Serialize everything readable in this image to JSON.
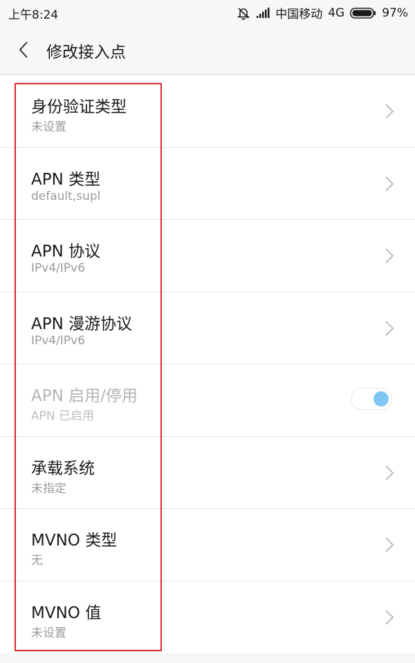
{
  "status_bar": {
    "time": "上午8:24",
    "carrier": "中国移动",
    "network": "4G",
    "battery": "97%",
    "icons": [
      "bell-off-icon",
      "signal-icon",
      "battery-icon"
    ]
  },
  "title_bar": {
    "back_icon": "chevron-left-icon",
    "title": "修改接入点"
  },
  "settings": {
    "items": [
      {
        "title": "身份验证类型",
        "subtitle": "未设置",
        "control": "chevron"
      },
      {
        "title": "APN 类型",
        "subtitle": "default,supl",
        "control": "chevron"
      },
      {
        "title": "APN 协议",
        "subtitle": "IPv4/IPv6",
        "control": "chevron"
      },
      {
        "title": "APN 漫游协议",
        "subtitle": "IPv4/IPv6",
        "control": "chevron"
      },
      {
        "title": "APN 启用/停用",
        "subtitle": "APN 已启用",
        "control": "toggle",
        "enabled": false,
        "toggle_on": true
      },
      {
        "title": "承载系统",
        "subtitle": "未指定",
        "control": "chevron"
      },
      {
        "title": "MVNO 类型",
        "subtitle": "无",
        "control": "chevron"
      },
      {
        "title": "MVNO 值",
        "subtitle": "未设置",
        "control": "chevron"
      }
    ]
  },
  "colors": {
    "highlight": "#d9252c",
    "toggle_knob": "#7fc6f5"
  }
}
